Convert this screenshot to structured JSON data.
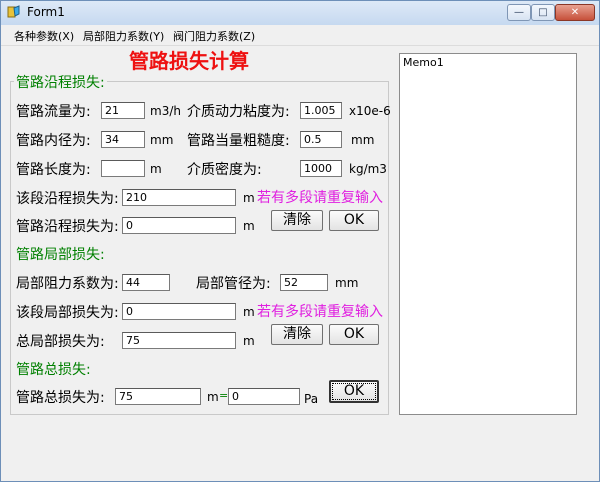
{
  "window": {
    "title": "Form1"
  },
  "menu": [
    "各种参数(X)",
    "局部阻力系数(Y)",
    "阀门阻力系数(Z)"
  ],
  "heading": "管路损失计算",
  "along": {
    "title": "管路沿程损失:",
    "flow_label": "管路流量为:",
    "flow_value": "21",
    "flow_unit": "m3/h",
    "viscosity_label": "介质动力粘度为:",
    "viscosity_value": "1.005",
    "viscosity_unit": "x10e-6",
    "diameter_label": "管路内径为:",
    "diameter_value": "34",
    "diameter_unit": "mm",
    "roughness_label": "管路当量粗糙度:",
    "roughness_value": "0.5",
    "roughness_unit": "mm",
    "length_label": "管路长度为:",
    "length_value": "",
    "length_unit": "m",
    "density_label": "介质密度为:",
    "density_value": "1000",
    "density_unit": "kg/m3",
    "segment_label": "该段沿程损失为:",
    "segment_value": "210",
    "segment_unit": "m",
    "hint": "若有多段请重复输入",
    "total_label": "管路沿程损失为:",
    "total_value": "0",
    "total_unit": "m",
    "clear": "清除",
    "ok": "OK"
  },
  "local": {
    "title": "管路局部损失:",
    "coef_label": "局部阻力系数为:",
    "coef_value": "44",
    "dia_label": "局部管径为:",
    "dia_value": "52",
    "dia_unit": "mm",
    "segment_label": "该段局部损失为:",
    "segment_value": "0",
    "segment_unit": "m",
    "hint": "若有多段请重复输入",
    "total_label": "总局部损失为:",
    "total_value": "75",
    "total_unit": "m",
    "clear": "清除",
    "ok": "OK"
  },
  "total": {
    "title": "管路总损失:",
    "label": "管路总损失为:",
    "value_m": "75",
    "unit_m": "m",
    "eq": "=",
    "value_pa": "0",
    "unit_pa": "Pa",
    "ok": "OK"
  },
  "memo": {
    "text": "Memo1"
  },
  "colors": {
    "section": "#008000",
    "heading": "#ee1111",
    "hint": "#e020e0"
  }
}
